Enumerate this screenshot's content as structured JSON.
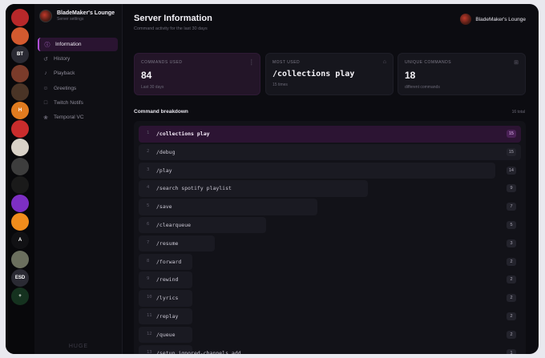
{
  "rail": {
    "items": [
      {
        "kind": "avatar",
        "color": "#b8282a",
        "label": ""
      },
      {
        "kind": "avatar",
        "color": "#d35a2f",
        "label": ""
      },
      {
        "kind": "text",
        "color": "#2a2a33",
        "label": "BT"
      },
      {
        "kind": "avatar",
        "color": "#7a3b2a",
        "label": ""
      },
      {
        "kind": "avatar",
        "color": "#4a3426",
        "label": ""
      },
      {
        "kind": "text",
        "color": "#e07b1f",
        "label": "H"
      },
      {
        "kind": "avatar",
        "color": "#c92c2c",
        "label": ""
      },
      {
        "kind": "avatar",
        "color": "#d9d2c8",
        "label": ""
      },
      {
        "kind": "avatar",
        "color": "#3d3d3d",
        "label": ""
      },
      {
        "kind": "avatar",
        "color": "#1a1a1a",
        "label": ""
      },
      {
        "kind": "avatar",
        "color": "#7d2fc4",
        "label": ""
      },
      {
        "kind": "avatar",
        "color": "#f08c1c",
        "label": ""
      },
      {
        "kind": "text",
        "color": "#111114",
        "label": "A"
      },
      {
        "kind": "avatar",
        "color": "#6b6f5e",
        "label": ""
      },
      {
        "kind": "text",
        "color": "#2a2a33",
        "label": "ESD"
      },
      {
        "kind": "text",
        "color": "#15321f",
        "label": "+"
      }
    ]
  },
  "server": {
    "name": "BladeMaker's Lounge",
    "subtitle": "Server settings"
  },
  "nav": {
    "items": [
      {
        "label": "Information",
        "icon": "info-icon",
        "active": true
      },
      {
        "label": "History",
        "icon": "history-icon",
        "active": false
      },
      {
        "label": "Playback",
        "icon": "music-note-icon",
        "active": false
      },
      {
        "label": "Greetings",
        "icon": "greeting-icon",
        "active": false
      },
      {
        "label": "Twitch Notifs",
        "icon": "twitch-icon",
        "active": false
      },
      {
        "label": "Temporal VC",
        "icon": "voice-icon",
        "active": false
      }
    ],
    "footer": "HUGE"
  },
  "header": {
    "title": "Server Information",
    "subtitle": "Command activity for the last 30 days",
    "user": "BladeMaker's Lounge"
  },
  "cards": [
    {
      "label": "COMMANDS USED",
      "value": "84",
      "foot": "Last 30 days",
      "icon": "chart-icon"
    },
    {
      "label": "MOST USED",
      "value": "/collections play",
      "foot": "15 times",
      "icon": "trophy-icon"
    },
    {
      "label": "UNIQUE COMMANDS",
      "value": "18",
      "foot": "different commands",
      "icon": "grid-icon"
    }
  ],
  "breakdown": {
    "title": "Command breakdown",
    "count": "16 total",
    "max": 15,
    "rows": [
      {
        "rank": "1",
        "command": "/collections play",
        "count": 15
      },
      {
        "rank": "2",
        "command": "/debug",
        "count": 15
      },
      {
        "rank": "3",
        "command": "/play",
        "count": 14
      },
      {
        "rank": "4",
        "command": "/search spotify playlist",
        "count": 9
      },
      {
        "rank": "5",
        "command": "/save",
        "count": 7
      },
      {
        "rank": "6",
        "command": "/clearqueue",
        "count": 5
      },
      {
        "rank": "7",
        "command": "/resume",
        "count": 3
      },
      {
        "rank": "8",
        "command": "/forward",
        "count": 2
      },
      {
        "rank": "9",
        "command": "/rewind",
        "count": 2
      },
      {
        "rank": "10",
        "command": "/lyrics",
        "count": 2
      },
      {
        "rank": "11",
        "command": "/replay",
        "count": 2
      },
      {
        "rank": "12",
        "command": "/queue",
        "count": 2
      },
      {
        "rank": "13",
        "command": "/setup ignored-channels add",
        "count": 1
      }
    ]
  }
}
